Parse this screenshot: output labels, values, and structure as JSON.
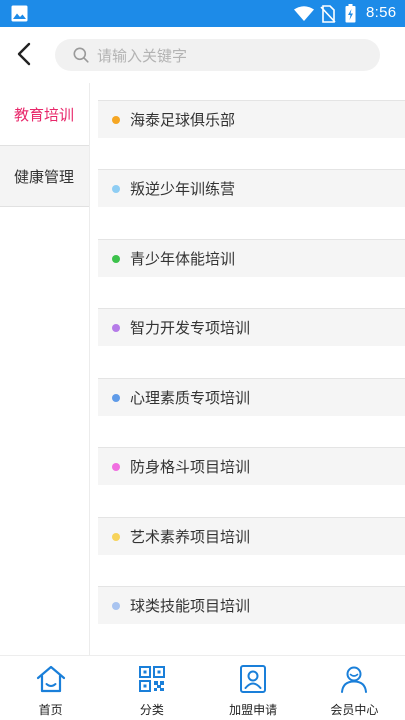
{
  "status_bar": {
    "time": "8:56",
    "icons": [
      "image-icon",
      "wifi-icon",
      "no-sim-icon",
      "battery-icon"
    ]
  },
  "header": {
    "search_placeholder": "请输入关键字",
    "icons": [
      "back-arrow-icon",
      "search-icon"
    ]
  },
  "sidebar": {
    "items": [
      {
        "label": "教育培训",
        "active": true
      },
      {
        "label": "健康管理",
        "active": false
      }
    ]
  },
  "list": {
    "items": [
      {
        "label": "海泰足球俱乐部",
        "dot_color": "#f5a623"
      },
      {
        "label": "叛逆少年训练营",
        "dot_color": "#8ecdf3"
      },
      {
        "label": "青少年体能培训",
        "dot_color": "#3cc24b"
      },
      {
        "label": "智力开发专项培训",
        "dot_color": "#b57be8"
      },
      {
        "label": "心理素质专项培训",
        "dot_color": "#5f9be8"
      },
      {
        "label": "防身格斗项目培训",
        "dot_color": "#f06ee0"
      },
      {
        "label": "艺术素养项目培训",
        "dot_color": "#f7d35a"
      },
      {
        "label": "球类技能项目培训",
        "dot_color": "#a9c4f0"
      }
    ]
  },
  "bottom_nav": {
    "tabs": [
      {
        "label": "首页",
        "icon": "home-icon"
      },
      {
        "label": "分类",
        "icon": "qrcode-icon"
      },
      {
        "label": "加盟申请",
        "icon": "user-card-icon"
      },
      {
        "label": "会员中心",
        "icon": "user-icon"
      }
    ]
  },
  "colors": {
    "status_bar": "#1d8be8",
    "accent": "#e8276a",
    "nav_icon": "#1a7fd9"
  }
}
